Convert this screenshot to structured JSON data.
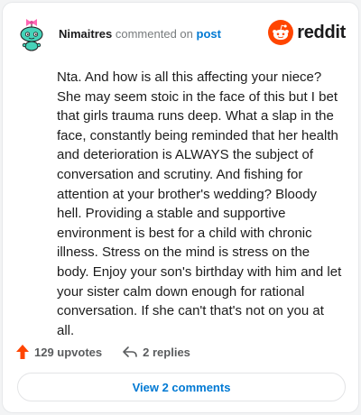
{
  "comment": {
    "username": "Nimaitres",
    "action_text": "commented on",
    "link_text": "post",
    "body": "Nta. And how is all this affecting your niece? She may seem stoic in the face of this but I bet that girls trauma runs deep. What a slap in the face, constantly being reminded that her health and deterioration is ALWAYS the subject of conversation and scrutiny. And fishing for attention at your brother's wedding? Bloody hell. Providing a stable and supportive environment is best for a child with chronic illness. Stress on the mind is stress on the body. Enjoy your son's birthday with him and let your sister calm down enough for rational conversation. If she can't that's not on you at all."
  },
  "brand": {
    "name": "reddit",
    "icon": "reddit-logo-icon",
    "color": "#ff4500"
  },
  "footer": {
    "upvotes_label": "129 upvotes",
    "replies_label": "2 replies",
    "upvote_icon": "upvote-arrow-icon",
    "reply_icon": "reply-arrow-icon",
    "upvote_color": "#ff4500"
  },
  "actions": {
    "view_comments_label": "View 2 comments"
  },
  "avatar": {
    "icon": "snoo-avatar-icon",
    "colors": {
      "body": "#46d3b9",
      "bow": "#ff66b3"
    }
  }
}
